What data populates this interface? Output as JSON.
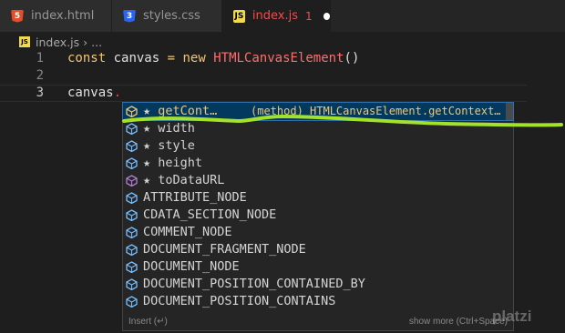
{
  "tabs": [
    {
      "name": "index.html",
      "icon": "html5-icon",
      "active": false
    },
    {
      "name": "styles.css",
      "icon": "css3-icon",
      "active": false
    },
    {
      "name": "index.js",
      "icon": "js-icon",
      "active": true,
      "problems": "1",
      "dirty": true
    }
  ],
  "breadcrumb": {
    "file": "index.js",
    "separator": "›",
    "rest": "..."
  },
  "code": {
    "lines": [
      {
        "number": "1",
        "tokens": [
          "const",
          "canvas",
          "=",
          "new",
          "HTMLCanvasElement",
          "()"
        ]
      },
      {
        "number": "2"
      },
      {
        "number": "3",
        "tokens": [
          "canvas",
          "."
        ]
      }
    ]
  },
  "suggestions": {
    "items": [
      {
        "label": "getCont…",
        "starred": true,
        "kind": "method",
        "detail": "(method) HTMLCanvasElement.getContext…",
        "selected": true
      },
      {
        "label": "width",
        "starred": true,
        "kind": "field"
      },
      {
        "label": "style",
        "starred": true,
        "kind": "field"
      },
      {
        "label": "height",
        "starred": true,
        "kind": "field"
      },
      {
        "label": "toDataURL",
        "starred": true,
        "kind": "method"
      },
      {
        "label": "ATTRIBUTE_NODE",
        "starred": false,
        "kind": "field"
      },
      {
        "label": "CDATA_SECTION_NODE",
        "starred": false,
        "kind": "field"
      },
      {
        "label": "COMMENT_NODE",
        "starred": false,
        "kind": "field"
      },
      {
        "label": "DOCUMENT_FRAGMENT_NODE",
        "starred": false,
        "kind": "field"
      },
      {
        "label": "DOCUMENT_NODE",
        "starred": false,
        "kind": "field"
      },
      {
        "label": "DOCUMENT_POSITION_CONTAINED_BY",
        "starred": false,
        "kind": "field"
      },
      {
        "label": "DOCUMENT_POSITION_CONTAINS",
        "starred": false,
        "kind": "field"
      }
    ],
    "footer_left": "Insert (↵)",
    "footer_right": "show more (Ctrl+Space)"
  },
  "watermark": "platzi",
  "colors": {
    "keyword": "#f0c674",
    "class": "#ff6e6e",
    "highlight_stroke": "#a4e22a",
    "selection": "#04395e"
  }
}
